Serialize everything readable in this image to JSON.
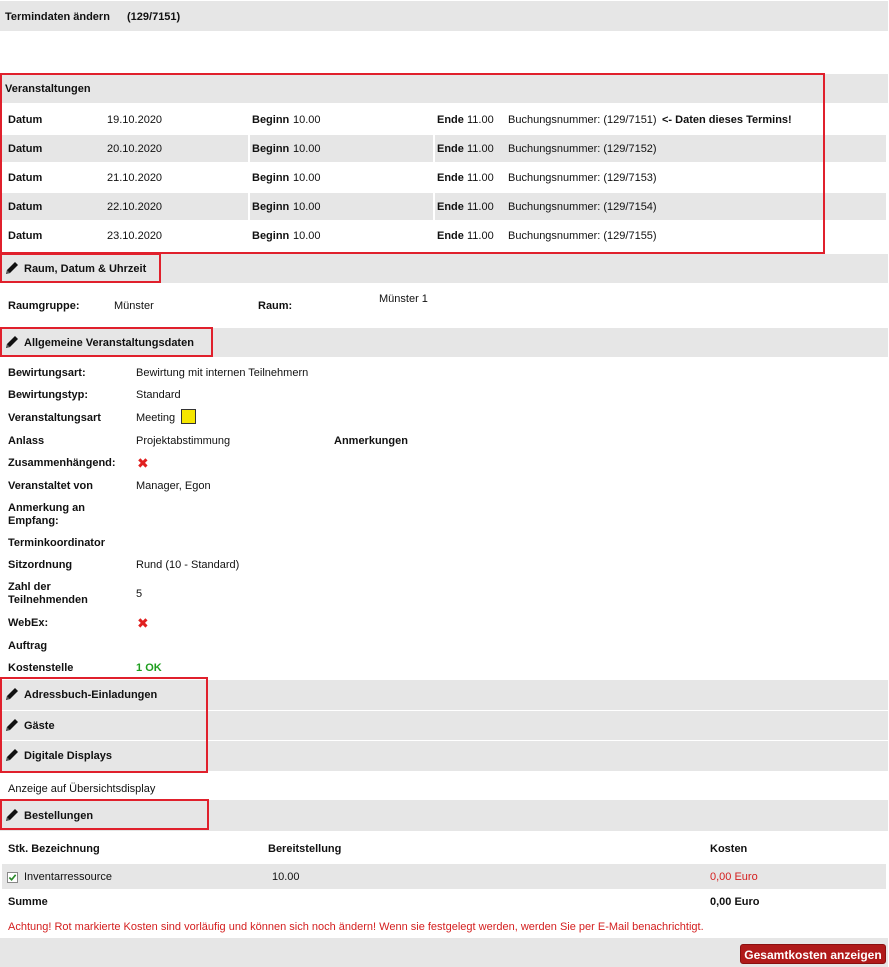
{
  "title": "Termindaten ändern",
  "booking_id": "(129/7151)",
  "events": {
    "heading": "Veranstaltungen",
    "datum_label": "Datum",
    "beginn_label": "Beginn",
    "ende_label": "Ende",
    "rows": [
      {
        "date": "19.10.2020",
        "begin": "10.00",
        "end": "11.00",
        "booking": "Buchungsnummer: (129/7151)",
        "note": "<- Daten dieses Termins!"
      },
      {
        "date": "20.10.2020",
        "begin": "10.00",
        "end": "11.00",
        "booking": "Buchungsnummer: (129/7152)",
        "note": ""
      },
      {
        "date": "21.10.2020",
        "begin": "10.00",
        "end": "11.00",
        "booking": "Buchungsnummer: (129/7153)",
        "note": ""
      },
      {
        "date": "22.10.2020",
        "begin": "10.00",
        "end": "11.00",
        "booking": "Buchungsnummer: (129/7154)",
        "note": ""
      },
      {
        "date": "23.10.2020",
        "begin": "10.00",
        "end": "11.00",
        "booking": "Buchungsnummer: (129/7155)",
        "note": ""
      }
    ]
  },
  "room": {
    "heading": "Raum, Datum & Uhrzeit",
    "group_label": "Raumgruppe:",
    "group_value": "Münster",
    "room_label": "Raum:",
    "room_value": "Münster 1"
  },
  "general": {
    "heading": "Allgemeine Veranstaltungsdaten",
    "bewirtungsart_label": "Bewirtungsart:",
    "bewirtungsart_value": "Bewirtung mit internen Teilnehmern",
    "bewirtungstyp_label": "Bewirtungstyp:",
    "bewirtungstyp_value": "Standard",
    "veranstaltungsart_label": "Veranstaltungsart",
    "veranstaltungsart_value": "Meeting",
    "veranstaltungsart_color": "#f5e600",
    "anlass_label": "Anlass",
    "anlass_value": "Projektabstimmung",
    "anmerkungen_label": "Anmerkungen",
    "zusammen_label": "Zusammenhängend:",
    "veranstaltet_label": "Veranstaltet von",
    "veranstaltet_value": "Manager, Egon",
    "anmerkung_empfang_label_1": "Anmerkung an",
    "anmerkung_empfang_label_2": "Empfang:",
    "terminkoordinator_label": "Terminkoordinator",
    "sitzordnung_label": "Sitzordnung",
    "sitzordnung_value": "Rund (10 - Standard)",
    "teilnehmer_label_1": "Zahl der",
    "teilnehmer_label_2": "Teilnehmenden",
    "teilnehmer_value": "5",
    "webex_label": "WebEx:",
    "auftrag_label": "Auftrag",
    "kostenstelle_label": "Kostenstelle",
    "kostenstelle_value": "1",
    "kostenstelle_status": "OK"
  },
  "sections": {
    "adressbuch": "Adressbuch-Einladungen",
    "gaeste": "Gäste",
    "displays": "Digitale Displays",
    "display_note": "Anzeige auf Übersichtsdisplay",
    "bestellungen": "Bestellungen"
  },
  "orders": {
    "col_stk": "Stk. Bezeichnung",
    "col_bereit": "Bereitstellung",
    "col_kosten": "Kosten",
    "rows": [
      {
        "name": "Inventarressource",
        "time": "10.00",
        "cost": "0,00 Euro",
        "checked": true
      }
    ],
    "summe_label": "Summe",
    "summe_value": "0,00 Euro",
    "warning": "Achtung! Rot markierte Kosten sind vorläufig und können sich noch ändern! Wenn sie festgelegt werden, werden Sie per E-Mail benachrichtigt."
  },
  "button_label": "Gesamtkosten anzeigen",
  "colors": {
    "accent_red": "#e0202c",
    "button": "#b01a1a",
    "ok_green": "#1e9e1e"
  }
}
